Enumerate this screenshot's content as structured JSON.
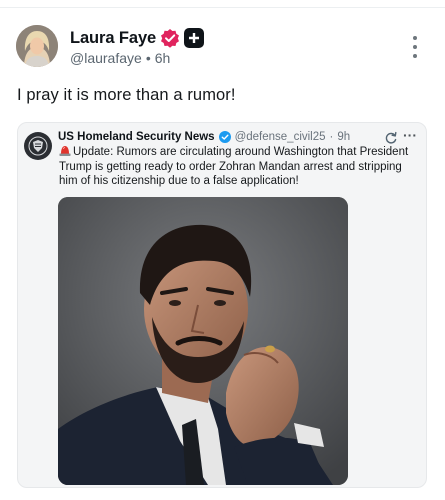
{
  "post": {
    "author": {
      "display_name": "Laura Faye",
      "handle": "@laurafaye",
      "time": "6h",
      "separator": "•"
    },
    "text": "I pray it is more than a rumor!",
    "icons": {
      "verified": "verified-badge-icon",
      "plus": "plus-badge-icon",
      "more": "more-vertical-icon"
    },
    "colors": {
      "verified_badge": "#e0245e",
      "plus_badge": "#0f1419"
    }
  },
  "quote": {
    "author": {
      "display_name": "US Homeland Security News",
      "handle": "@defense_civil25",
      "time": "9h",
      "separator": "·"
    },
    "text": "Update: Rumors are circulating around Washington that President Trump is getting ready to order Zohran Mandan arrest and stripping him of his citizenship due to a false application!",
    "more_label": "···",
    "icons": {
      "avatar": "shield-logo-icon",
      "verified": "verified-check-icon",
      "refresh": "refresh-icon",
      "siren": "siren-emoji-icon"
    },
    "colors": {
      "verified_check": "#1d9bf0",
      "siren": "#e0342d"
    }
  }
}
